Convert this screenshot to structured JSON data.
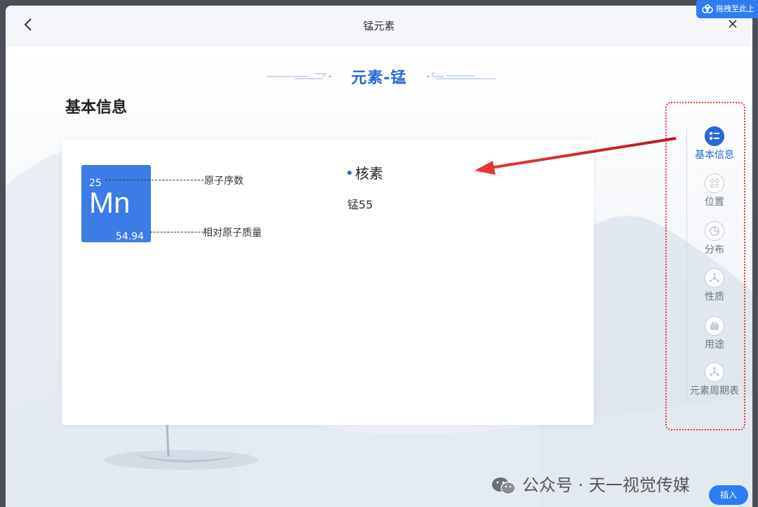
{
  "window": {
    "title": "锰元素"
  },
  "badge": {
    "label": "拖拽至此上"
  },
  "header": {
    "title": "元素-锰"
  },
  "section": {
    "title": "基本信息"
  },
  "element": {
    "atomic_number": "25",
    "symbol": "Mn",
    "atomic_mass": "54.94",
    "atomic_number_label": "原子序数",
    "atomic_mass_label": "相对原子质量",
    "tile_color": "#3d7be6"
  },
  "isotope": {
    "heading": "核素",
    "value": "锰55"
  },
  "sidenav": {
    "items": [
      {
        "label": "基本信息",
        "icon": "list-icon",
        "active": true
      },
      {
        "label": "位置",
        "icon": "grid-dots-icon",
        "active": false
      },
      {
        "label": "分布",
        "icon": "pie-chart-icon",
        "active": false
      },
      {
        "label": "性质",
        "icon": "molecule-icon",
        "active": false
      },
      {
        "label": "用途",
        "icon": "usage-icon",
        "active": false
      },
      {
        "label": "元素周期表",
        "icon": "periodic-table-icon",
        "active": false
      }
    ]
  },
  "watermark": {
    "text": "公众号 · 天一视觉传媒"
  },
  "insert_button": {
    "label": "插入"
  },
  "colors": {
    "accent": "#2767d8",
    "annotation": "#e53935"
  }
}
